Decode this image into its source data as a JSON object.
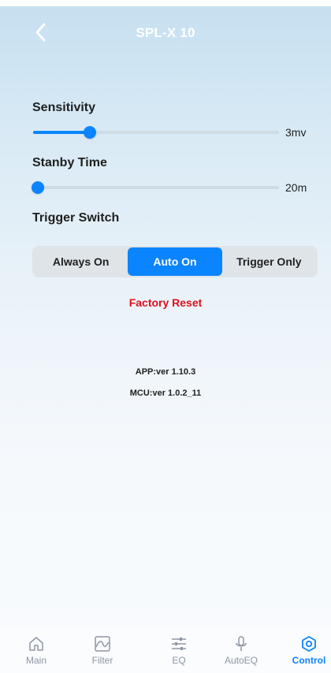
{
  "header": {
    "title": "SPL-X 10"
  },
  "sensitivity": {
    "label": "Sensitivity",
    "value_text": "3mv",
    "level": 0.23
  },
  "standby": {
    "label": "Stanby Time",
    "value_text": "20m",
    "level": 0.02
  },
  "trigger": {
    "label": "Trigger Switch",
    "options": [
      "Always On",
      "Auto On",
      "Trigger Only"
    ],
    "selected": "Auto On"
  },
  "factory_reset_label": "Factory Reset",
  "version": {
    "app": "APP:ver 1.10.3",
    "mcu": "MCU:ver 1.0.2_11"
  },
  "nav": {
    "items": [
      {
        "label": "Main",
        "icon": "home-icon"
      },
      {
        "label": "Filter",
        "icon": "filter-icon"
      },
      {
        "label": "EQ",
        "icon": "eq-icon"
      },
      {
        "label": "AutoEQ",
        "icon": "microphone-icon"
      },
      {
        "label": "Control",
        "icon": "control-icon"
      }
    ],
    "active": "Control"
  },
  "colors": {
    "accent": "#0a84ff",
    "danger": "#e0101a",
    "inactive_nav": "#8e96a3"
  }
}
